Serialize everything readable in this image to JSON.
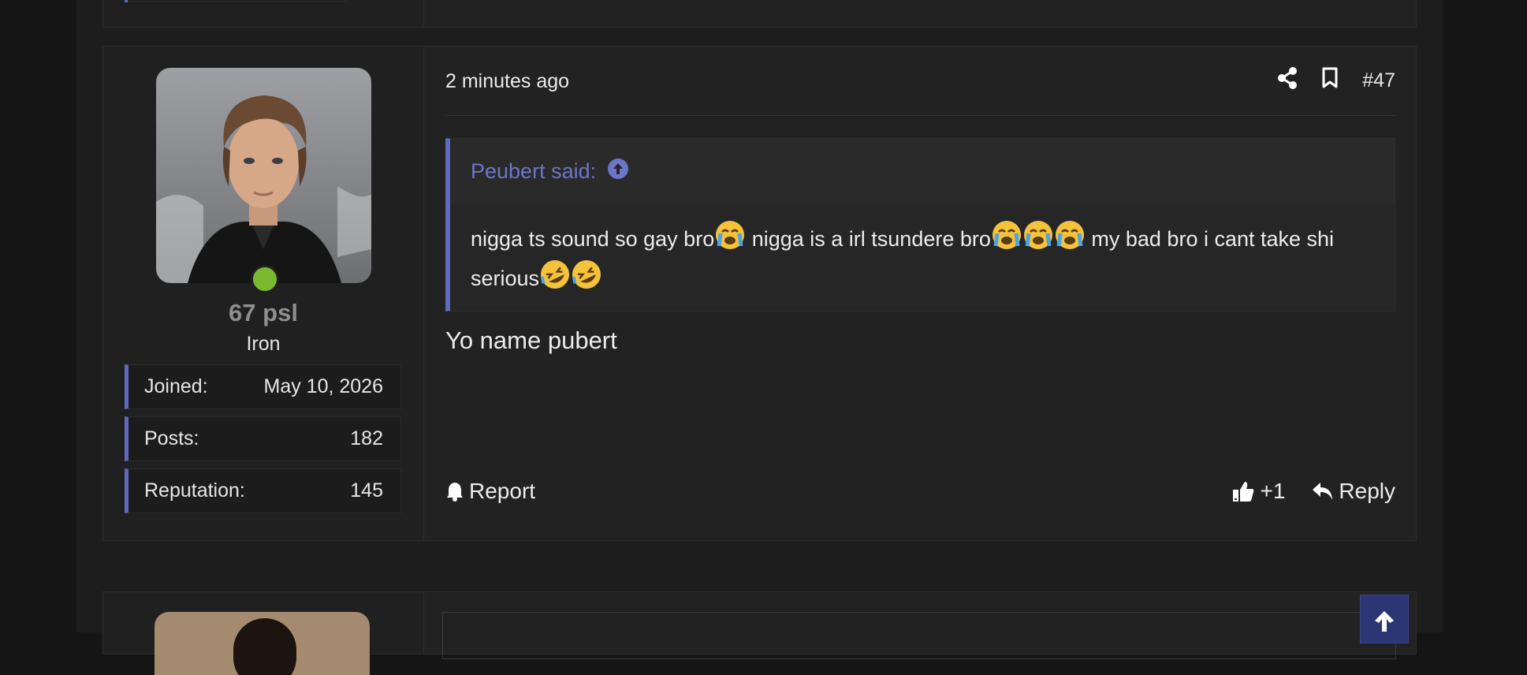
{
  "post": {
    "timestamp": "2 minutes ago",
    "post_number": "#47",
    "user": {
      "username": "67 psl",
      "title": "Iron",
      "stats": [
        {
          "label": "Joined:",
          "value": "May 10, 2026"
        },
        {
          "label": "Posts:",
          "value": "182"
        },
        {
          "label": "Reputation:",
          "value": "145"
        }
      ]
    },
    "quote": {
      "author_said": "Peubert said:",
      "text_1": "nigga ts sound so gay bro",
      "text_2": " nigga is a irl tsundere bro",
      "text_3": " my bad bro i cant take shi serious",
      "emoji_1": "loudly-crying-face",
      "emoji_2": "rolling-on-floor-laughing"
    },
    "message": "Yo name pubert",
    "actions": {
      "report_label": "Report",
      "like_count": "+1",
      "reply_label": "Reply"
    }
  },
  "icons": [
    "share-icon",
    "bookmark-icon",
    "arrow-up-circle-icon",
    "bell-icon",
    "thumbs-up-icon",
    "reply-icon",
    "arrow-up-icon"
  ],
  "colors": {
    "accent": "#5c6bc0",
    "online": "#7cb82f",
    "quote_author": "#6b76c9"
  }
}
